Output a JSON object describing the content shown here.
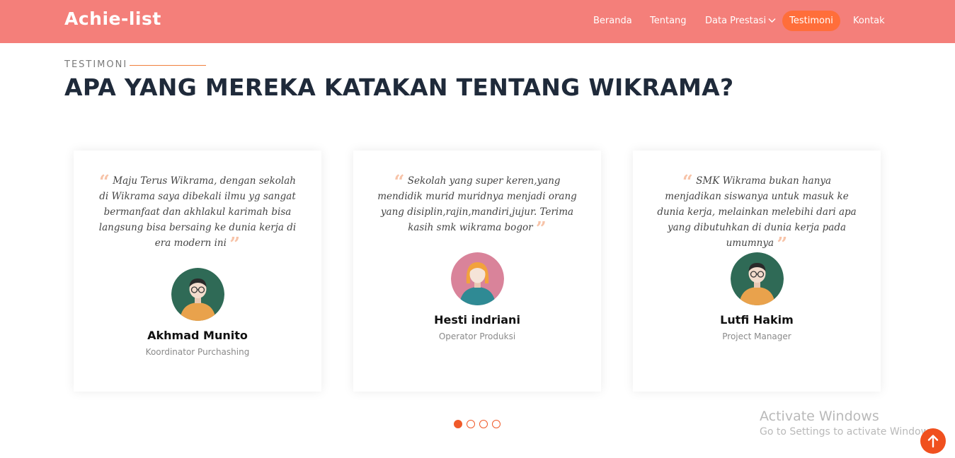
{
  "header": {
    "logo": "Achie-list",
    "nav": [
      {
        "label": "Beranda"
      },
      {
        "label": "Tentang"
      },
      {
        "label": "Data Prestasi"
      },
      {
        "label": "Testimoni"
      },
      {
        "label": "Kontak"
      }
    ]
  },
  "section": {
    "eyebrow": "TESTIMONI",
    "title": "APA YANG MEREKA KATAKAN TENTANG WIKRAMA?"
  },
  "testimonials": [
    {
      "quote": "Maju Terus Wikrama, dengan sekolah di Wikrama saya dibekali ilmu yg sangat bermanfaat dan akhlakul karimah bisa langsung bisa bersaing ke dunia kerja di era modern ini",
      "name": "Akhmad Munito",
      "role": "Koordinator Purchashing",
      "avatar": "male-avatar-icon"
    },
    {
      "quote": "Sekolah yang super keren,yang mendidik murid muridnya menjadi orang yang disiplin,rajin,mandiri,jujur. Terima kasih smk wikrama bogor",
      "name": "Hesti indriani",
      "role": "Operator Produksi",
      "avatar": "female-avatar-icon"
    },
    {
      "quote": "SMK Wikrama bukan hanya menjadikan siswanya untuk masuk ke dunia kerja, melainkan melebihi dari apa yang dibutuhkan di dunia kerja pada umumnya",
      "name": "Lutfi Hakim",
      "role": "Project Manager",
      "avatar": "male-avatar-icon"
    }
  ],
  "pagination": {
    "total": 4,
    "active": 1
  },
  "watermark": {
    "title": "Activate Windows",
    "subtitle": "Go to Settings to activate Windows."
  },
  "colors": {
    "header_bg": "#f47f7a",
    "accent": "#ff6e3a",
    "quote_mark": "#f7c3a8"
  }
}
